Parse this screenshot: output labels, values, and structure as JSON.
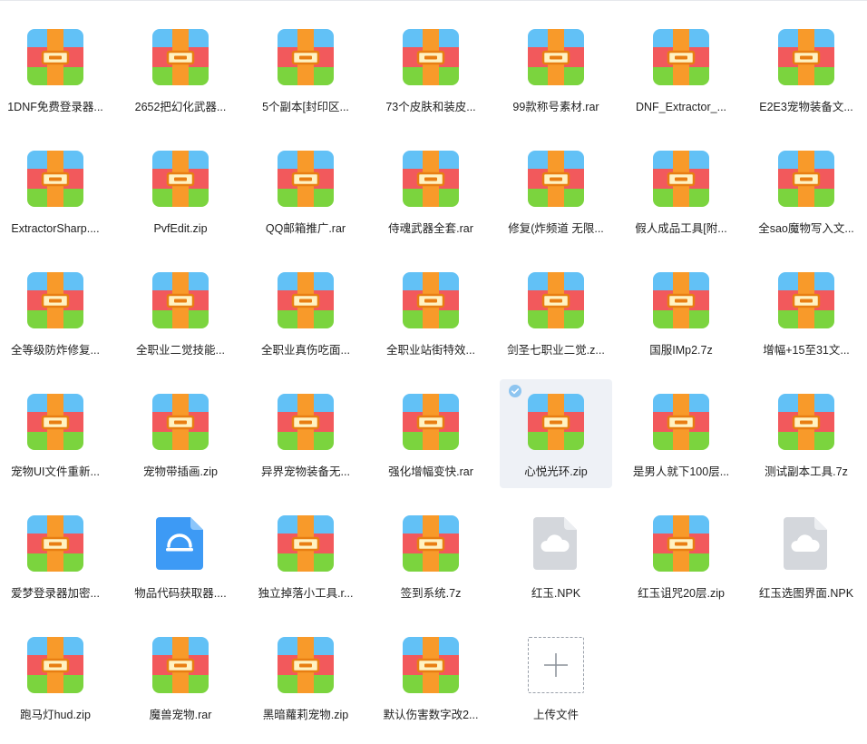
{
  "files": [
    {
      "name": "1DNF免费登录器...",
      "type": "archive"
    },
    {
      "name": "2652把幻化武器...",
      "type": "archive"
    },
    {
      "name": "5个副本[封印区...",
      "type": "archive"
    },
    {
      "name": "73个皮肤和装皮...",
      "type": "archive"
    },
    {
      "name": "99款称号素材.rar",
      "type": "archive"
    },
    {
      "name": "DNF_Extractor_...",
      "type": "archive"
    },
    {
      "name": "E2E3宠物装备文...",
      "type": "archive"
    },
    {
      "name": "ExtractorSharp....",
      "type": "archive"
    },
    {
      "name": "PvfEdit.zip",
      "type": "archive"
    },
    {
      "name": "QQ邮箱推广.rar",
      "type": "archive"
    },
    {
      "name": "侍魂武器全套.rar",
      "type": "archive"
    },
    {
      "name": "修复(炸频道 无限...",
      "type": "archive"
    },
    {
      "name": "假人成品工具[附...",
      "type": "archive"
    },
    {
      "name": "全sao魔物写入文...",
      "type": "archive"
    },
    {
      "name": "全等级防炸修复...",
      "type": "archive"
    },
    {
      "name": "全职业二觉技能...",
      "type": "archive"
    },
    {
      "name": "全职业真伤吃面...",
      "type": "archive"
    },
    {
      "name": "全职业站街特效...",
      "type": "archive"
    },
    {
      "name": "剑圣七职业二觉.z...",
      "type": "archive"
    },
    {
      "name": "国服IMp2.7z",
      "type": "archive"
    },
    {
      "name": "增幅+15至31文...",
      "type": "archive"
    },
    {
      "name": "宠物UI文件重新...",
      "type": "archive"
    },
    {
      "name": "宠物带插画.zip",
      "type": "archive"
    },
    {
      "name": "异界宠物装备无...",
      "type": "archive"
    },
    {
      "name": "强化增幅变快.rar",
      "type": "archive"
    },
    {
      "name": "心悦光环.zip",
      "type": "archive",
      "selected": true
    },
    {
      "name": "是男人就下100层...",
      "type": "archive"
    },
    {
      "name": "测试副本工具.7z",
      "type": "archive"
    },
    {
      "name": "爱梦登录器加密...",
      "type": "archive"
    },
    {
      "name": "物品代码获取器....",
      "type": "app"
    },
    {
      "name": "独立掉落小工具.r...",
      "type": "archive"
    },
    {
      "name": "签到系统.7z",
      "type": "archive"
    },
    {
      "name": "红玉.NPK",
      "type": "unknown"
    },
    {
      "name": "红玉诅咒20层.zip",
      "type": "archive"
    },
    {
      "name": "红玉选图界面.NPK",
      "type": "unknown"
    },
    {
      "name": "跑马灯hud.zip",
      "type": "archive"
    },
    {
      "name": "魔兽宠物.rar",
      "type": "archive"
    },
    {
      "name": "黑暗蘿莉宠物.zip",
      "type": "archive"
    },
    {
      "name": "默认伤害数字改2...",
      "type": "archive"
    }
  ],
  "upload": {
    "label": "上传文件"
  },
  "icons": {
    "archive": "archive-file-icon",
    "app": "app-file-icon",
    "unknown": "unknown-file-icon",
    "upload": "plus-icon",
    "check": "check-icon"
  },
  "colors": {
    "archive_top": "#62c1f6",
    "archive_mid": "#f2595c",
    "archive_bottom": "#7bd43e",
    "archive_strap": "#f89a2a",
    "selected_bg": "#eef1f6",
    "check": "#8ec5f0"
  }
}
